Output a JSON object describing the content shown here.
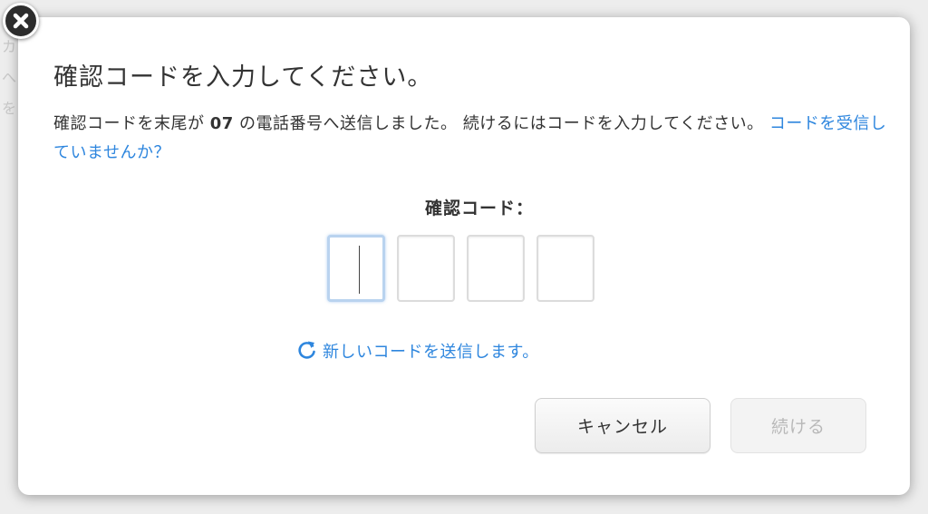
{
  "dialog": {
    "title": "確認コードを入力してください。",
    "description": {
      "part1": "確認コードを末尾が ",
      "phone_suffix": "07",
      "part2": " の電話番号へ送信しました。 続けるにはコードを入力してください。 ",
      "link": "コードを受信していませんか？"
    },
    "code_label": "確認コード：",
    "code_digits": [
      "",
      "",
      "",
      ""
    ],
    "resend_label": "新しいコードを送信します。",
    "cancel_label": "キャンセル",
    "continue_label": "続ける"
  },
  "icons": {
    "close": "close-icon",
    "resend": "refresh-icon"
  },
  "colors": {
    "link": "#2e86de",
    "text": "#333333",
    "disabled_text": "#b8b8b8",
    "active_box_border": "#b9d3ef"
  }
}
